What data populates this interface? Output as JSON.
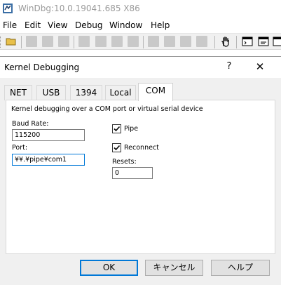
{
  "app": {
    "title": "WinDbg:10.0.19041.685 X86",
    "menu": [
      "File",
      "Edit",
      "View",
      "Debug",
      "Window",
      "Help"
    ]
  },
  "toolbar": {
    "icons": [
      "open-folder-icon",
      "cut-icon",
      "copy-icon",
      "paste-icon",
      "source-mode-icon",
      "go-icon",
      "step-into-icon",
      "step-over-icon",
      "step-out-icon",
      "run-to-cursor-icon",
      "breakpoint-icon",
      "hand-icon",
      "command-window-icon",
      "watch-window-icon",
      "locals-icon"
    ]
  },
  "dialog": {
    "title": "Kernel Debugging",
    "help_symbol": "?",
    "close_symbol": "✕",
    "tabs": [
      {
        "label": "NET",
        "active": false
      },
      {
        "label": "USB",
        "active": false
      },
      {
        "label": "1394",
        "active": false
      },
      {
        "label": "Local",
        "active": false
      },
      {
        "label": "COM",
        "active": true
      }
    ],
    "com": {
      "description": "Kernel debugging over a COM port or virtual serial device",
      "baud_rate_label": "Baud Rate:",
      "baud_rate_value": "115200",
      "port_label": "Port:",
      "port_value": "¥¥.¥pipe¥com1",
      "pipe_label": "Pipe",
      "pipe_checked": true,
      "reconnect_label": "Reconnect",
      "reconnect_checked": true,
      "resets_label": "Resets:",
      "resets_value": "0"
    },
    "buttons": {
      "ok": "OK",
      "cancel": "キャンセル",
      "help": "ヘルプ"
    }
  },
  "colors": {
    "accent": "#0078d7",
    "dialog_bg": "#f0f0f0",
    "panel_bg": "#ffffff"
  }
}
